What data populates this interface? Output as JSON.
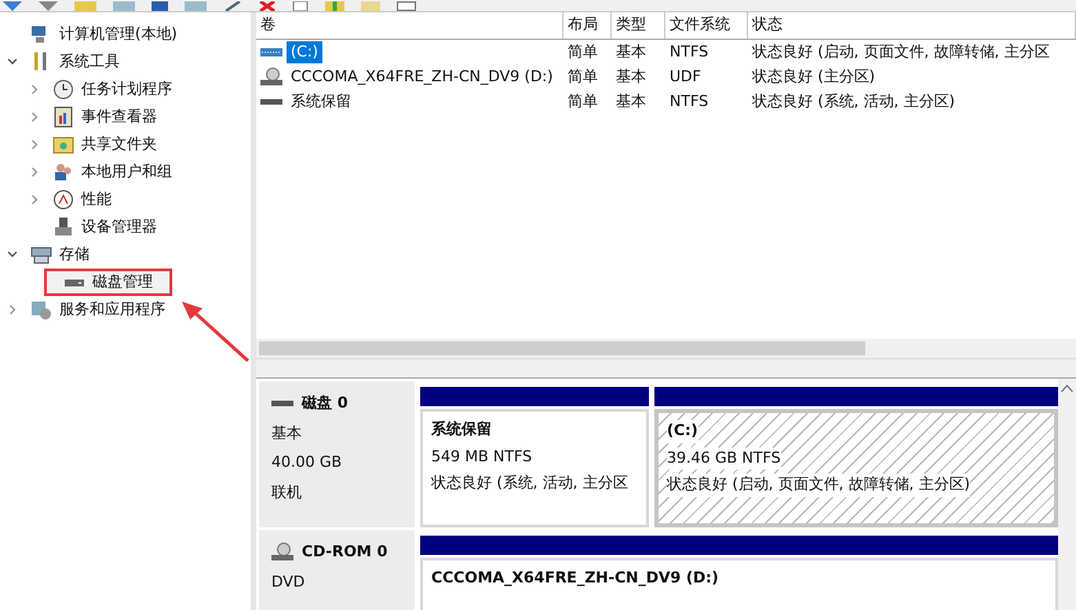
{
  "tree": [
    {
      "label": "计算机管理(本地)",
      "selected": false,
      "children": [
        {
          "label": "系统工具",
          "expanded": true,
          "selected": false,
          "children": [
            {
              "label": "任务计划程序",
              "expanded": false,
              "selected": false
            },
            {
              "label": "事件查看器",
              "expanded": false,
              "selected": false
            },
            {
              "label": "共享文件夹",
              "expanded": false,
              "selected": false
            },
            {
              "label": "本地用户和组",
              "expanded": false,
              "selected": false
            },
            {
              "label": "性能",
              "expanded": false,
              "selected": false
            },
            {
              "label": "设备管理器",
              "selected": false
            }
          ]
        },
        {
          "label": "存储",
          "expanded": true,
          "selected": false,
          "children": [
            {
              "label": "磁盘管理",
              "selected": true
            }
          ]
        },
        {
          "label": "服务和应用程序",
          "expanded": false,
          "selected": false
        }
      ]
    }
  ],
  "volumes": {
    "columns": [
      "卷",
      "布局",
      "类型",
      "文件系统",
      "状态"
    ],
    "rows": [
      {
        "kind": "hdd",
        "name": "(C:)",
        "layout": "简单",
        "type": "基本",
        "fs": "NTFS",
        "status": "状态良好 (启动, 页面文件, 故障转储, 主分区",
        "selected": true
      },
      {
        "kind": "cd",
        "name": "CCCOMA_X64FRE_ZH-CN_DV9 (D:)",
        "layout": "简单",
        "type": "基本",
        "fs": "UDF",
        "status": "状态良好 (主分区)",
        "selected": false
      },
      {
        "kind": "drive",
        "name": "系统保留",
        "layout": "简单",
        "type": "基本",
        "fs": "NTFS",
        "status": "状态良好 (系统, 活动, 主分区)",
        "selected": false
      }
    ]
  },
  "disks": [
    {
      "kind": "hdd",
      "name": "磁盘 0",
      "details": [
        "基本",
        "40.00 GB",
        "联机"
      ],
      "partitions": [
        {
          "name": "系统保留",
          "size": "549 MB NTFS",
          "status": "状态良好 (系统, 活动, 主分区",
          "selected": false
        },
        {
          "name": "(C:)",
          "size": "39.46 GB NTFS",
          "status": "状态良好 (启动, 页面文件, 故障转储, 主分区)",
          "selected": true
        }
      ]
    },
    {
      "kind": "cd",
      "name": "CD-ROM 0",
      "details": [
        "DVD"
      ],
      "partitions": [
        {
          "name": "CCCOMA_X64FRE_ZH-CN_DV9  (D:)",
          "selected": false
        }
      ]
    }
  ]
}
